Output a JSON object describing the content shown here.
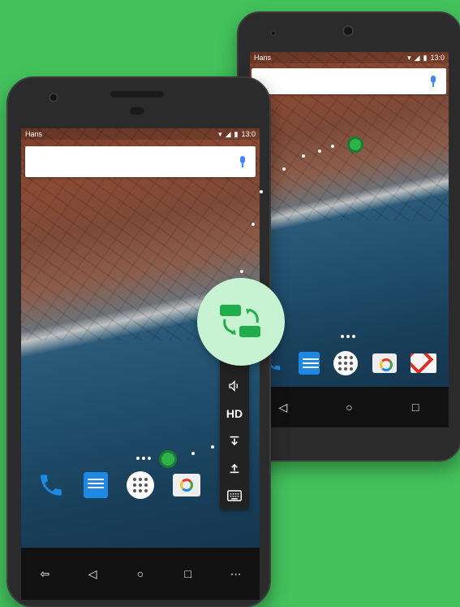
{
  "status_bar": {
    "carrier": "Hans",
    "time": "13:0"
  },
  "front_phone": {
    "dock_apps": [
      "phone-icon",
      "messages-icon",
      "apps-drawer-icon",
      "camera-icon"
    ],
    "nav_buttons": {
      "exit": "⇦",
      "back": "◁",
      "home": "○",
      "recents": "□",
      "more": "⋯"
    }
  },
  "back_phone": {
    "dock_apps": [
      "phone-icon",
      "messages-icon",
      "apps-drawer-icon",
      "camera-icon",
      "gmail-icon"
    ],
    "nav_buttons": {
      "back": "◁",
      "home": "○",
      "recents": "□"
    }
  },
  "toolbar": {
    "items": [
      "square-icon",
      "volume-icon",
      "hd-icon",
      "download-icon",
      "upload-icon",
      "keyboard-icon"
    ],
    "hd_label": "HD"
  },
  "colors": {
    "background": "#43c25c",
    "accent_green": "#2fb24c",
    "sync_circle": "#c8f3d3"
  }
}
